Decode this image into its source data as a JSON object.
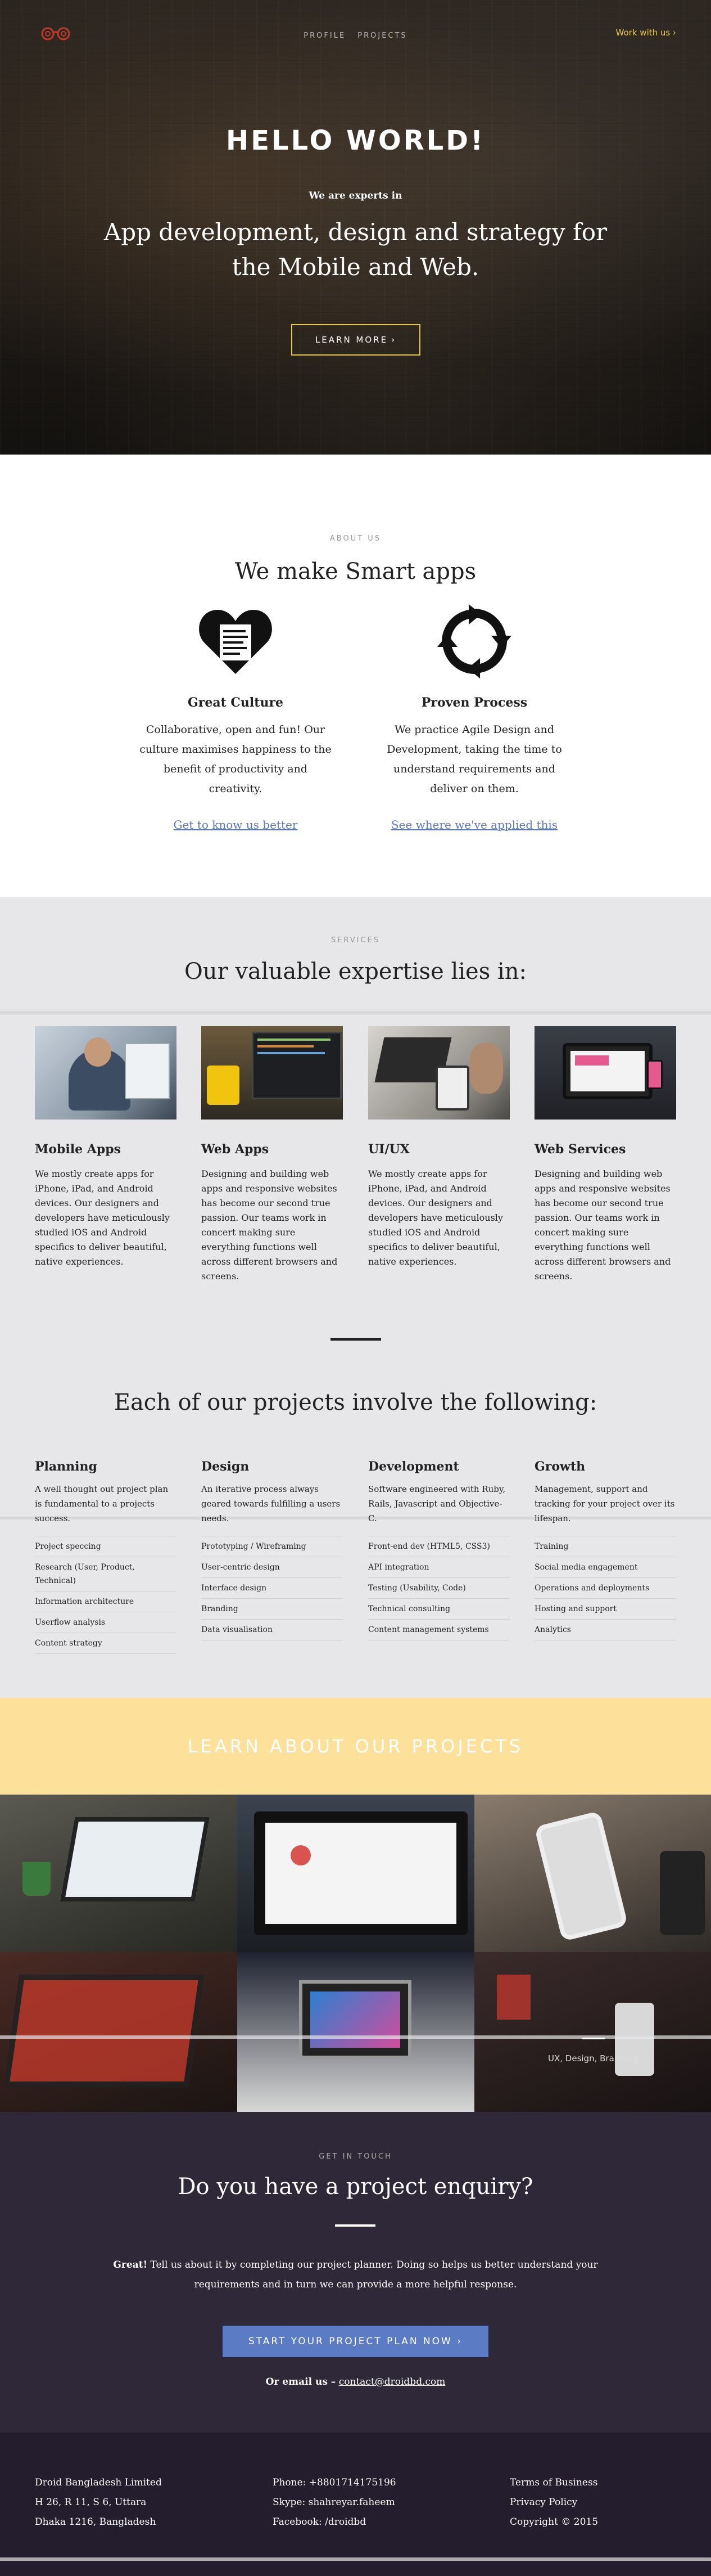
{
  "nav": {
    "links": [
      "PROFILE",
      "PROJECTS"
    ],
    "cta": "Work with us",
    "cta_arrow": "›"
  },
  "hero": {
    "title": "HELLO WORLD!",
    "kicker": "We are experts in",
    "tagline": "App development, design and strategy for the Mobile and Web.",
    "button": "LEARN MORE",
    "button_arrow": "›"
  },
  "about": {
    "eyebrow": "ABOUT US",
    "title": "We make Smart apps",
    "columns": [
      {
        "icon": "heart-document-icon",
        "title": "Great Culture",
        "text": "Collaborative, open and fun! Our culture maximises happiness to the benefit of productivity and creativity.",
        "link": "Get to know us better"
      },
      {
        "icon": "cycle-arrows-icon",
        "title": "Proven Process",
        "text": "We practice Agile Design and Development, taking the time to understand requirements and deliver on them.",
        "link": "See where we've applied this"
      }
    ]
  },
  "services": {
    "eyebrow": "SERVICES",
    "title": "Our valuable expertise lies in:",
    "items": [
      {
        "title": "Mobile Apps",
        "text": "We mostly create apps for iPhone, iPad, and Android devices. Our designers and developers have meticulously studied iOS and Android specifics to deliver beautiful, native experiences."
      },
      {
        "title": "Web Apps",
        "text": "Designing and building web apps and responsive websites has become our second true passion. Our teams work in concert making sure everything functions well across different browsers and screens."
      },
      {
        "title": "UI/UX",
        "text": "We mostly create apps for iPhone, iPad, and Android devices. Our designers and developers have meticulously studied iOS and Android specifics to deliver beautiful, native experiences."
      },
      {
        "title": "Web Services",
        "text": "Designing and building web apps and responsive websites has become our second true passion. Our teams work in concert making sure everything functions well across different browsers and screens."
      }
    ],
    "projects_title": "Each of our projects involve the following:",
    "projects": [
      {
        "title": "Planning",
        "text": "A well thought out project plan is fundamental to a projects success.",
        "list": [
          "Project speccing",
          "Research (User, Product, Technical)",
          "Information architecture",
          "Userflow analysis",
          "Content strategy"
        ]
      },
      {
        "title": "Design",
        "text": "An iterative process always geared towards fulfilling a users needs.",
        "list": [
          "Prototyping / Wireframing",
          "User-centric design",
          "Interface design",
          "Branding",
          "Data visualisation"
        ]
      },
      {
        "title": "Development",
        "text": "Software engineered with Ruby, Rails, Javascript and Objective-C.",
        "list": [
          "Front-end dev (HTML5, CSS3)",
          "API integration",
          "Testing (Usability, Code)",
          "Technical consulting",
          "Content management systems"
        ]
      },
      {
        "title": "Growth",
        "text": "Management, support and tracking for your project over its lifespan.",
        "list": [
          "Training",
          "Social media engagement",
          "Operations and deployments",
          "Hosting and support",
          "Analytics"
        ]
      }
    ]
  },
  "learn": {
    "label": "LEARN ABOUT OUR PROJECTS"
  },
  "gallery": {
    "caption": "UX, Design, Branding"
  },
  "contact": {
    "eyebrow": "GET IN TOUCH",
    "title": "Do you have a project enquiry?",
    "lead": "Great!",
    "desc": " Tell us about it by completing our project planner. Doing so helps us better understand your requirements and in turn we can provide a more helpful response.",
    "button": "START YOUR PROJECT PLAN NOW",
    "button_arrow": "›",
    "email_label": "Or email us –",
    "email": "contact@droidbd.com"
  },
  "footer": {
    "address": [
      "Droid Bangladesh Limited",
      "H 26, R 11, S 6, Uttara",
      "Dhaka 1216, Bangladesh"
    ],
    "contacts": [
      "Phone: +8801714175196",
      "Skype: shahreyar.faheem",
      "Facebook: /droidbd"
    ],
    "links": [
      "Terms of Business",
      "Privacy Policy",
      "Copyright © 2015"
    ]
  },
  "colors": {
    "accent_yellow": "#e8c84a",
    "banner_yellow": "#fde19a",
    "link_blue": "#5a78c0",
    "button_blue": "#5b7cc4",
    "contact_bg": "#2e2838",
    "footer_bg": "#231d2d",
    "services_bg": "#e7e7e9"
  }
}
